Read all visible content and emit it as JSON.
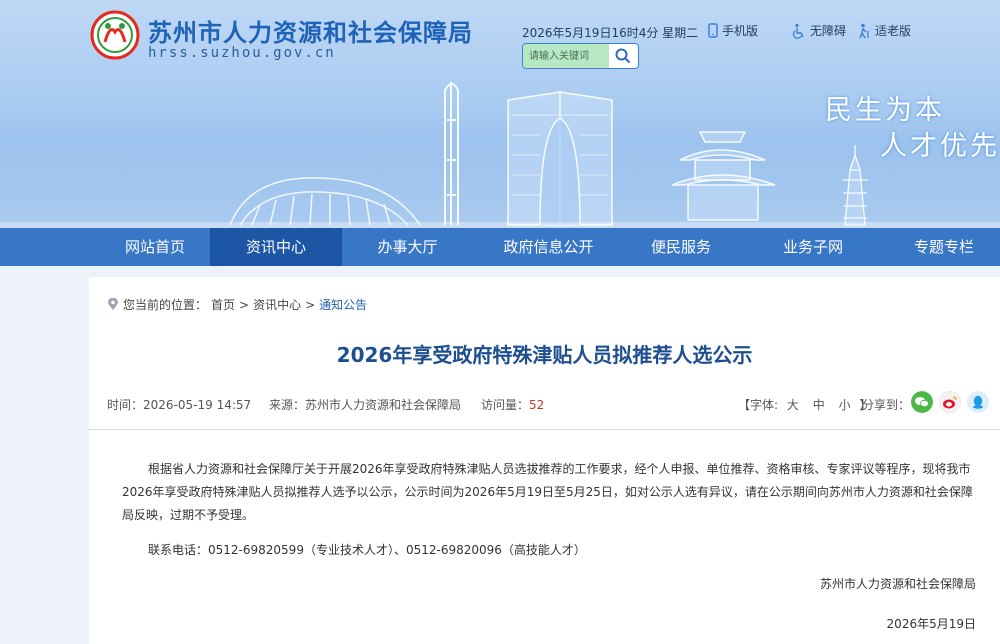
{
  "header": {
    "site_title": "苏州市人力资源和社会保障局",
    "site_domain": "hrss.suzhou.gov.cn",
    "datetime": "2026年5月19日16时4分 星期二",
    "links": {
      "mobile": "手机版",
      "accessible": "无障碍",
      "elderly": "适老版"
    },
    "search_placeholder": "请输入关键词",
    "slogan_line1": "民生为本",
    "slogan_line2": "人才优先"
  },
  "nav": {
    "items": [
      {
        "label": "网站首页"
      },
      {
        "label": "资讯中心"
      },
      {
        "label": "办事大厅"
      },
      {
        "label": "政府信息公开"
      },
      {
        "label": "便民服务"
      },
      {
        "label": "业务子网"
      },
      {
        "label": "专题专栏"
      }
    ],
    "active_index": 1
  },
  "breadcrumb": {
    "prefix": "您当前的位置：",
    "items": [
      "首页",
      "资讯中心",
      "通知公告"
    ],
    "separator": ">"
  },
  "article": {
    "title": "2026年享受政府特殊津贴人员拟推荐人选公示",
    "meta": {
      "time_label": "时间：",
      "time": "2026-05-19 14:57",
      "source_label": "来源：",
      "source": "苏州市人力资源和社会保障局",
      "views_label": "访问量：",
      "views": "52"
    },
    "font_size": {
      "prefix": "【字体:",
      "large": "大",
      "medium": "中",
      "small": "小",
      "suffix": "】"
    },
    "share_label": "分享到：",
    "share_icons": [
      "wechat-icon",
      "weibo-icon",
      "qq-icon"
    ],
    "body_paragraph": "根据省人力资源和社会保障厅关于开展2026年享受政府特殊津贴人员选拔推荐的工作要求，经个人申报、单位推荐、资格审核、专家评议等程序，现将我市2026年享受政府特殊津贴人员拟推荐人选予以公示，公示时间为2026年5月19日至5月25日，如对公示人选有异议，请在公示期间向苏州市人力资源和社会保障局反映，过期不予受理。",
    "contact": "联系电话：0512-69820599（专业技术人才）、0512-69820096（高技能人才）",
    "signature": "苏州市人力资源和社会保障局",
    "sign_date": "2026年5月19日"
  },
  "colors": {
    "nav_bg": "#3876c6",
    "nav_active": "#1e56a6",
    "title_blue": "#1d4e8f",
    "views_red": "#c0392b"
  }
}
